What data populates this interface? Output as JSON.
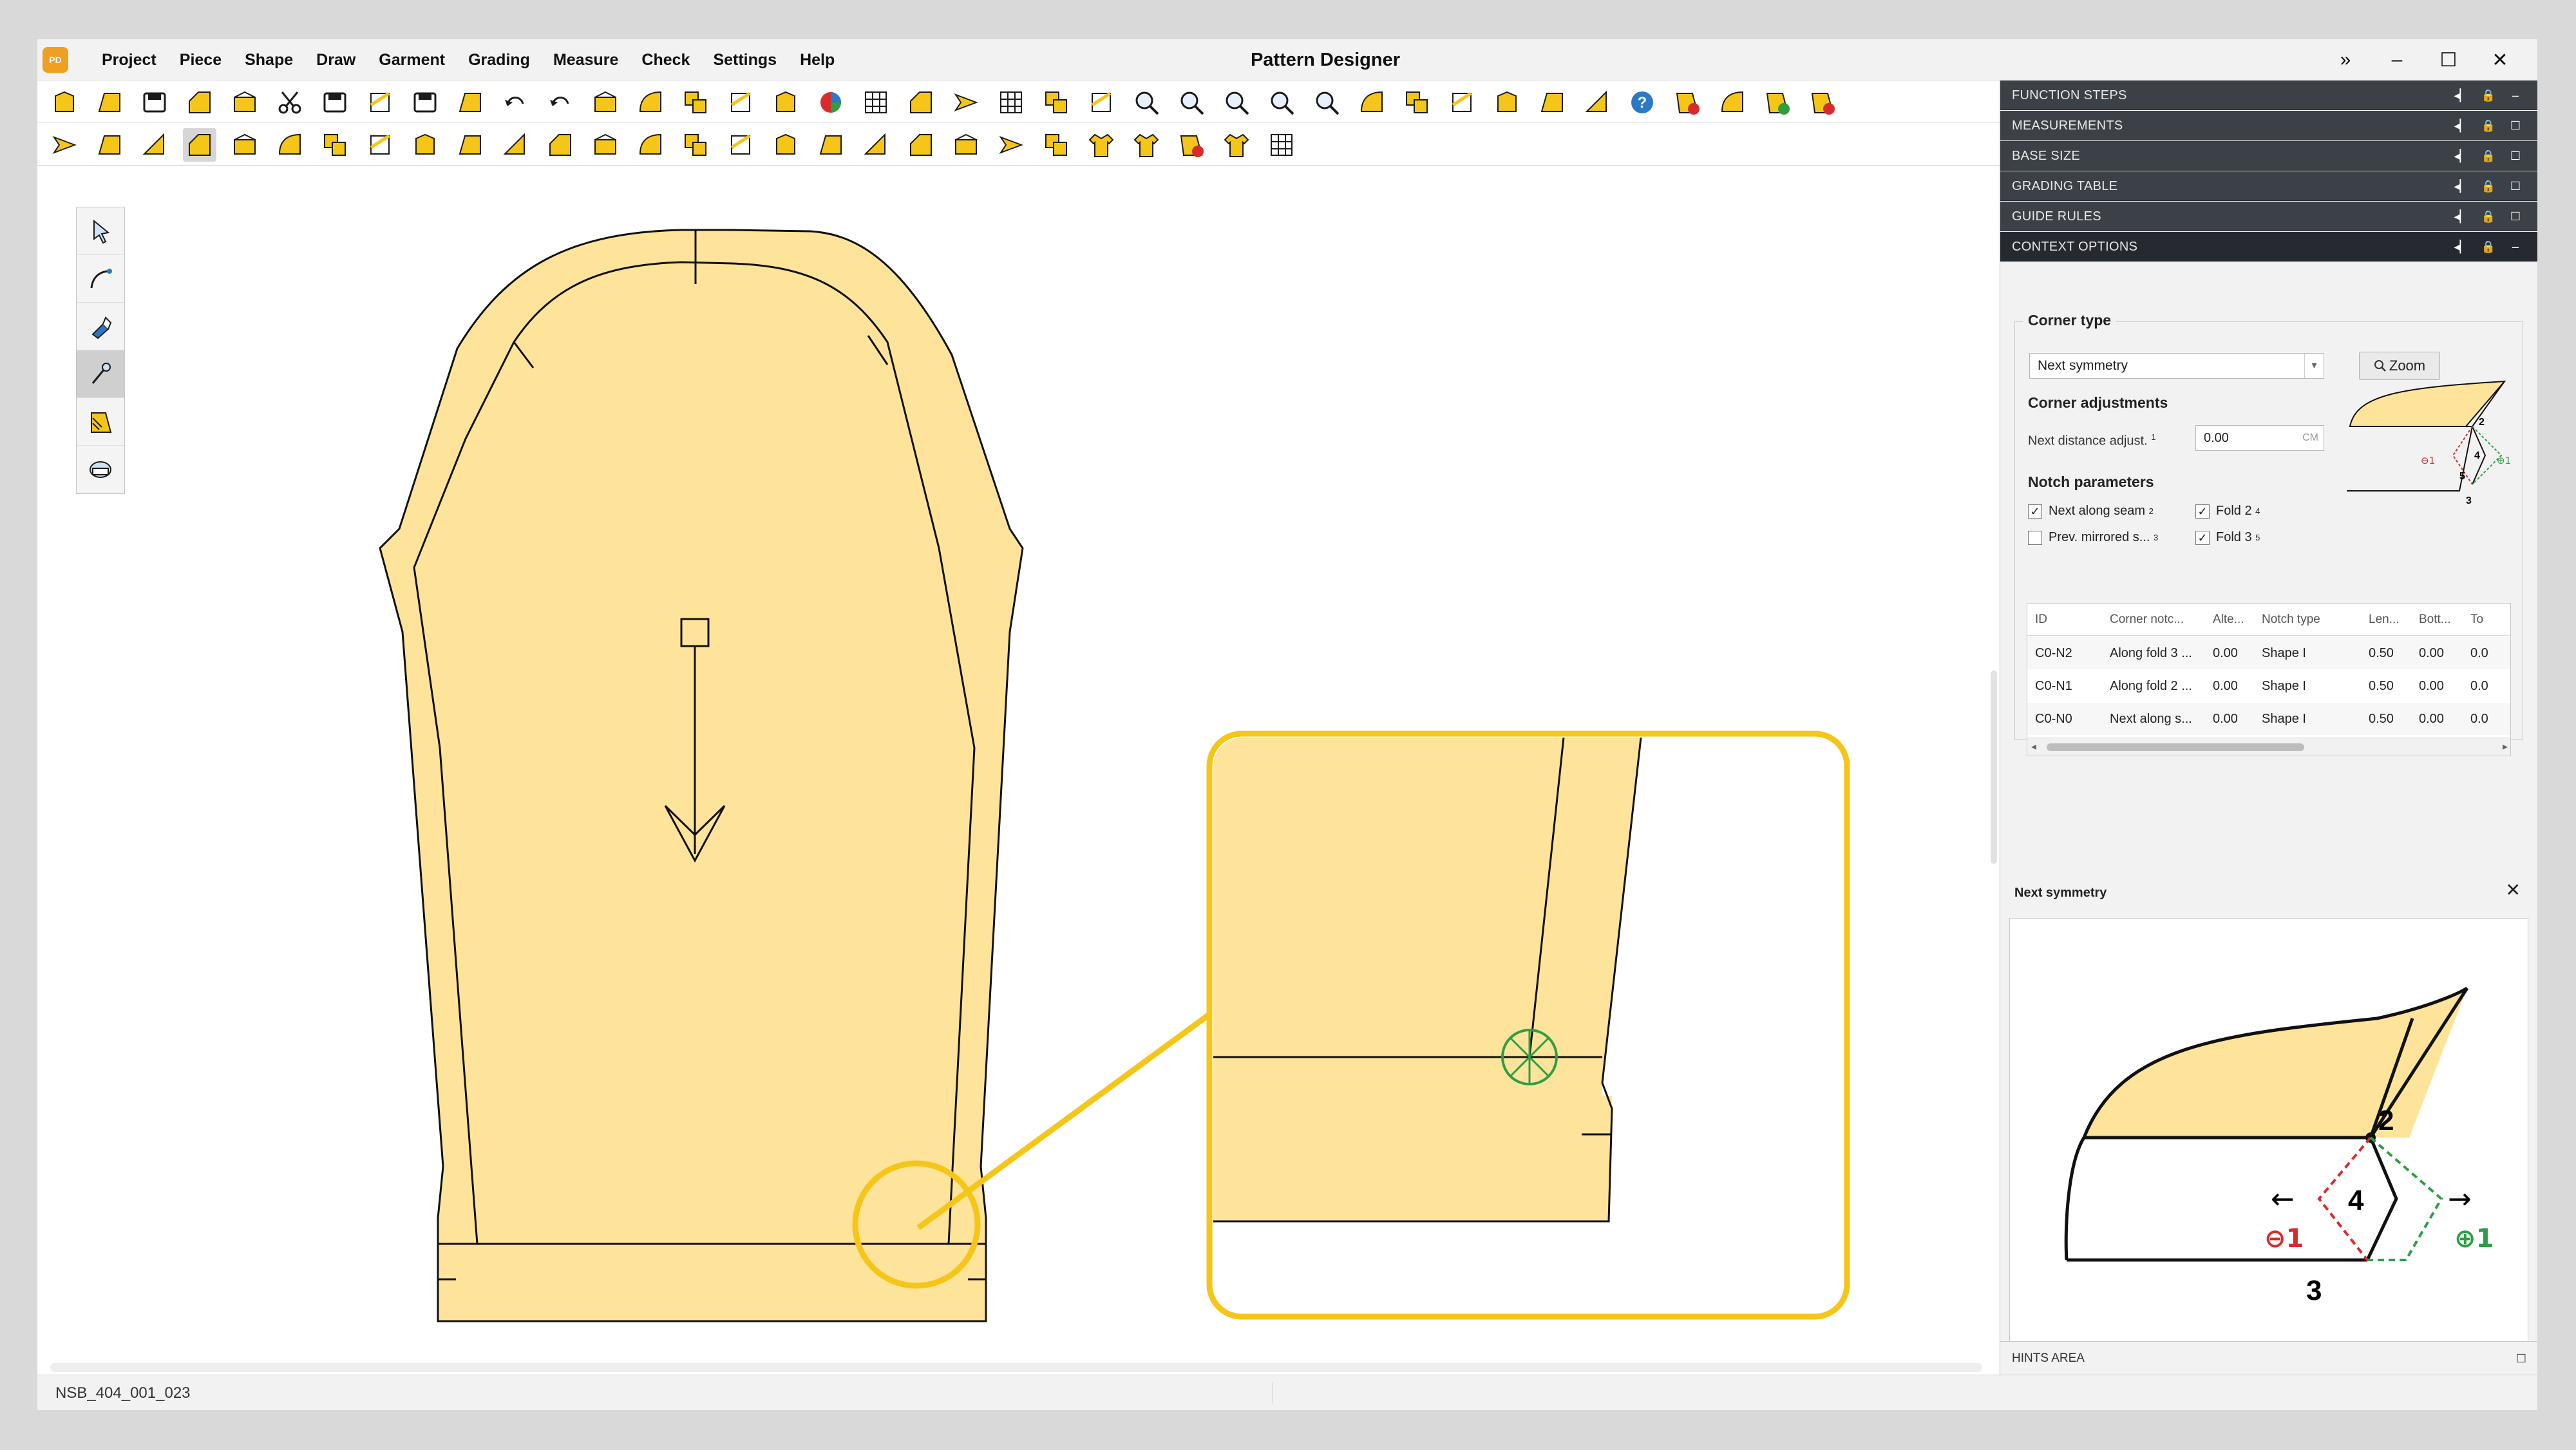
{
  "app": {
    "logo_text": "PD",
    "title": "Pattern Designer",
    "menu": [
      "Project",
      "Piece",
      "Shape",
      "Draw",
      "Garment",
      "Grading",
      "Measure",
      "Check",
      "Settings",
      "Help"
    ],
    "window_controls": [
      "»",
      "–",
      "☐",
      "✕"
    ]
  },
  "toolbar1_icons": [
    "new-piece-icon",
    "open-folder-icon",
    "save-icon",
    "piece-structure-icon",
    "import-icon",
    "cut-icon",
    "print-preview-icon",
    "report-icon",
    "plot-icon",
    "export-icon",
    "undo-icon",
    "redo-icon",
    "text-label-icon",
    "size-label-icon",
    "copy-piece-icon",
    "paste-piece-icon",
    "piece-outline-icon",
    "color-wheel-icon",
    "grid-icon",
    "piece-layout-icon",
    "arrow-menu-icon",
    "table-icon",
    "piece-fold-icon",
    "marker-icon",
    "zoom-fit-icon",
    "zoom-piece-icon",
    "zoom-selection-icon",
    "zoom-in-icon",
    "zoom-out-icon",
    "refresh-icon",
    "add-shape-icon",
    "measure-points-icon",
    "layers-icon",
    "export-data-icon",
    "slider-icon",
    "help-icon",
    "cancel-select-icon",
    "flags-icon",
    "check-ok-icon",
    "check-error-icon"
  ],
  "toolbar2_icons": [
    "draft-line-icon",
    "parallel-line-icon",
    "curve-tool-icon",
    "notch-tool-icon",
    "seam-tool-icon",
    "dart-tool-icon",
    "fold-tool-icon",
    "pleat-tool-icon",
    "piece-add-icon",
    "hem-tool-icon",
    "edge-tool-icon",
    "pocket-tool-icon",
    "split-tool-icon",
    "join-tool-icon",
    "align-tool-icon",
    "corner-tool-icon",
    "flip-corner-icon",
    "mirror-corner-icon",
    "ease-tool-icon",
    "hatch-tool-icon",
    "grade-tool-icon",
    "forward-tool-icon",
    "anchor-tool-icon",
    "add-garment-icon",
    "garment-icon",
    "garment-remove-icon",
    "garment-edit-icon",
    "garment-table-icon"
  ],
  "toolbar2_active": 3,
  "left_tools": [
    "select-arrow-icon",
    "curve-edit-icon",
    "point-edit-icon",
    "notch-pen-icon",
    "piece-ruler-icon",
    "tape-measure-icon"
  ],
  "left_tools_active": 3,
  "status_bar": {
    "text": "NSB_404_001_023"
  },
  "panels": {
    "accordion": [
      {
        "title": "FUNCTION STEPS",
        "state": "–"
      },
      {
        "title": "MEASUREMENTS",
        "state": "☐"
      },
      {
        "title": "BASE SIZE",
        "state": "☐"
      },
      {
        "title": "GRADING TABLE",
        "state": "☐"
      },
      {
        "title": "GUIDE RULES",
        "state": "☐"
      },
      {
        "title": "CONTEXT OPTIONS",
        "state": "–"
      }
    ],
    "accordion_ctrls": [
      "◂▏",
      "🔒"
    ],
    "context": {
      "corner_type_label": "Corner type",
      "corner_type_value": "Next symmetry",
      "select_arrow": "▾",
      "zoom_label": "Zoom",
      "adjust_label": "Corner adjustments",
      "next_distance_label": "Next distance adjust.",
      "next_distance_sup": "1",
      "next_distance_value": "0.00",
      "unit": "CM",
      "notch_label": "Notch parameters",
      "checkboxes": [
        {
          "label": "Next along seam",
          "sup": "2",
          "checked": "✓"
        },
        {
          "label": "Fold 2",
          "sup": "4",
          "checked": "✓"
        },
        {
          "label": "Prev. mirrored s...",
          "sup": "3",
          "checked": ""
        },
        {
          "label": "Fold 3",
          "sup": "5",
          "checked": "✓"
        }
      ],
      "mini_labels": {
        "n2": "2",
        "n4": "4",
        "n5": "5",
        "n3": "3",
        "minus": "⊖1",
        "plus": "⊕1"
      },
      "table": {
        "headers": [
          "ID",
          "Corner notc...",
          "Alte...",
          "Notch type",
          "Len...",
          "Bott...",
          "To"
        ],
        "rows": [
          [
            "C0-N2",
            "Along fold 3 ...",
            "0.00",
            "Shape I",
            "0.50",
            "0.00",
            "0.0"
          ],
          [
            "C0-N1",
            "Along fold 2 ...",
            "0.00",
            "Shape I",
            "0.50",
            "0.00",
            "0.0"
          ],
          [
            "C0-N0",
            "Next along s...",
            "0.00",
            "Shape I",
            "0.50",
            "0.00",
            "0.0"
          ]
        ],
        "scroll_left": "◂",
        "scroll_right": "▸"
      }
    },
    "preview": {
      "title": "Next symmetry",
      "close": "✕",
      "labels": {
        "n2": "2",
        "n4": "4",
        "n3": "3",
        "minus": "⊖1",
        "plus": "⊕1",
        "left_arrow": "←",
        "right_arrow": "→"
      }
    },
    "hints": {
      "title": "HINTS AREA",
      "ctrl": "☐"
    }
  },
  "colors": {
    "piece_fill": "#fde49a",
    "highlight": "#f5c518",
    "notch_green": "#2e9e44",
    "minus_red": "#d92b2b",
    "plus_green": "#2e9e44",
    "panel_header": "#3c4047"
  }
}
